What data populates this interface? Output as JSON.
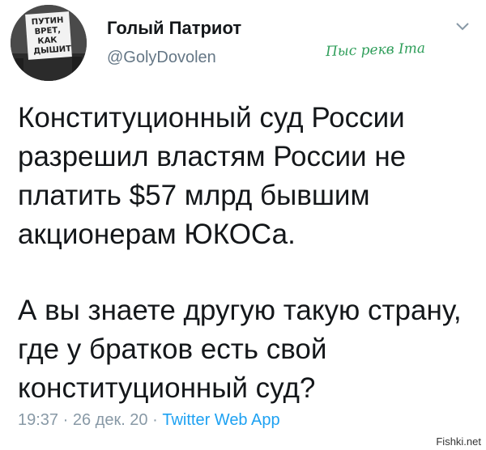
{
  "author": {
    "display_name": "Голый Патриот",
    "handle": "@GolyDovolen",
    "avatar_sign_text": "ПУТИН ВРЁТ, КАК ДЫШИТ"
  },
  "signature": "Пыс рекв Ima",
  "tweet": {
    "paragraph_1": "Конституционный суд России разрешил властям России не платить $57 млрд бывшим акционерам ЮКОСа.",
    "paragraph_2": "А вы знаете другую такую страну, где у братков есть свой конституционный суд?"
  },
  "meta": {
    "time": "19:37",
    "separator": " · ",
    "date": "26 дек. 20",
    "source": "Twitter Web App"
  },
  "site_watermark": "Fishki.net",
  "icons": {
    "menu": "chevron-down-icon"
  },
  "colors": {
    "text": "#14171a",
    "secondary": "#657786",
    "link": "#1da1f2",
    "signature": "#2f9e5a"
  }
}
